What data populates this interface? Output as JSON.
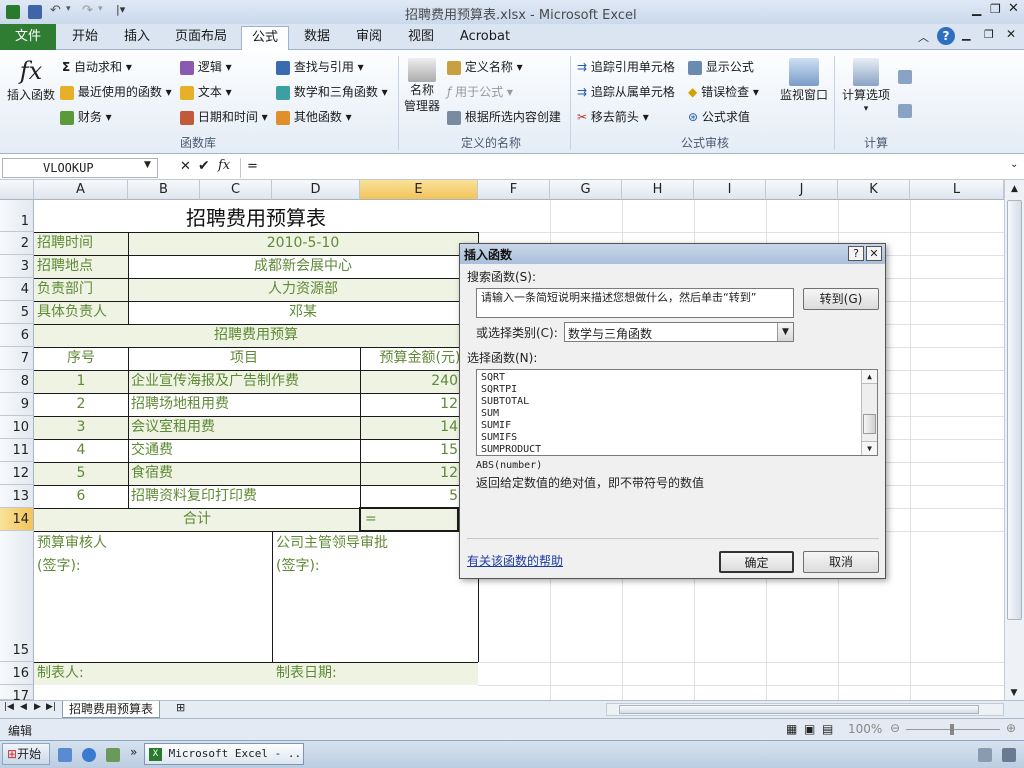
{
  "window": {
    "title": "招聘费用预算表.xlsx - Microsoft Excel"
  },
  "ribbon_tabs": {
    "file": "文件",
    "items": [
      "开始",
      "插入",
      "页面布局",
      "公式",
      "数据",
      "审阅",
      "视图",
      "Acrobat"
    ],
    "active": "公式"
  },
  "ribbon": {
    "insert_function": "插入函数",
    "autosum": "自动求和",
    "recent": "最近使用的函数",
    "financial": "财务",
    "logical": "逻辑",
    "text": "文本",
    "datetime": "日期和时间",
    "lookup": "查找与引用",
    "math": "数学和三角函数",
    "other": "其他函数",
    "group_library": "函数库",
    "name_manager_1": "名称",
    "name_manager_2": "管理器",
    "define_name": "定义名称",
    "use_in_formula": "用于公式",
    "create_from_selection": "根据所选内容创建",
    "group_names": "定义的名称",
    "trace_precedents": "追踪引用单元格",
    "trace_dependents": "追踪从属单元格",
    "remove_arrows": "移去箭头",
    "show_formulas": "显示公式",
    "error_checking": "错误检查",
    "evaluate_formula": "公式求值",
    "watch_window": "监视窗口",
    "group_audit": "公式审核",
    "calc_options": "计算选项",
    "group_calc": "计算"
  },
  "formula_bar": {
    "name_box": "VLOOKUP",
    "content": "="
  },
  "columns": [
    "A",
    "B",
    "C",
    "D",
    "E",
    "F",
    "G",
    "H",
    "I",
    "J",
    "K",
    "L"
  ],
  "rows": [
    "1",
    "2",
    "3",
    "4",
    "5",
    "6",
    "7",
    "8",
    "9",
    "10",
    "11",
    "12",
    "13",
    "14",
    "15",
    "16",
    "17"
  ],
  "sheet": {
    "title": "招聘费用预算表",
    "r2_label": "招聘时间",
    "r2_value": "2010-5-10",
    "r3_label": "招聘地点",
    "r3_value": "成都新会展中心",
    "r4_label": "负责部门",
    "r4_value": "人力资源部",
    "r5_label": "具体负责人",
    "r5_value": "邓某",
    "r6": "招聘费用预算",
    "h_no": "序号",
    "h_item": "项目",
    "h_amount": "预算金额(元)",
    "items": [
      {
        "no": "1",
        "item": "企业宣传海报及广告制作费",
        "amount": "240"
      },
      {
        "no": "2",
        "item": "招聘场地租用费",
        "amount": "12"
      },
      {
        "no": "3",
        "item": "会议室租用费",
        "amount": "14"
      },
      {
        "no": "4",
        "item": "交通费",
        "amount": "15"
      },
      {
        "no": "5",
        "item": "食宿费",
        "amount": "12"
      },
      {
        "no": "6",
        "item": "招聘资料复印打印费",
        "amount": "5"
      }
    ],
    "total_label": "合计",
    "total_value": "=",
    "reviewer": "预算审核人",
    "reviewer_sign": "(签字):",
    "approver": "公司主管领导审批",
    "approver_sign": "(签字):",
    "preparer": "制表人:",
    "prep_date": "制表日期:"
  },
  "sheet_tab": "招聘费用预算表",
  "dialog": {
    "title": "插入函数",
    "search_label": "搜索函数(S):",
    "search_value": "请输入一条简短说明来描述您想做什么，然后单击“转到”",
    "go": "转到(G)",
    "category_label": "或选择类别(C):",
    "category_value": "数学与三角函数",
    "select_label": "选择函数(N):",
    "functions": [
      "SQRT",
      "SQRTPI",
      "SUBTOTAL",
      "SUM",
      "SUMIF",
      "SUMIFS",
      "SUMPRODUCT"
    ],
    "signature": "ABS(number)",
    "description": "返回给定数值的绝对值，即不带符号的数值",
    "help": "有关该函数的帮助",
    "ok": "确定",
    "cancel": "取消"
  },
  "status": {
    "mode": "编辑",
    "zoom": "100%"
  },
  "taskbar": {
    "start": "开始",
    "excel": "Microsoft Excel - ..."
  }
}
